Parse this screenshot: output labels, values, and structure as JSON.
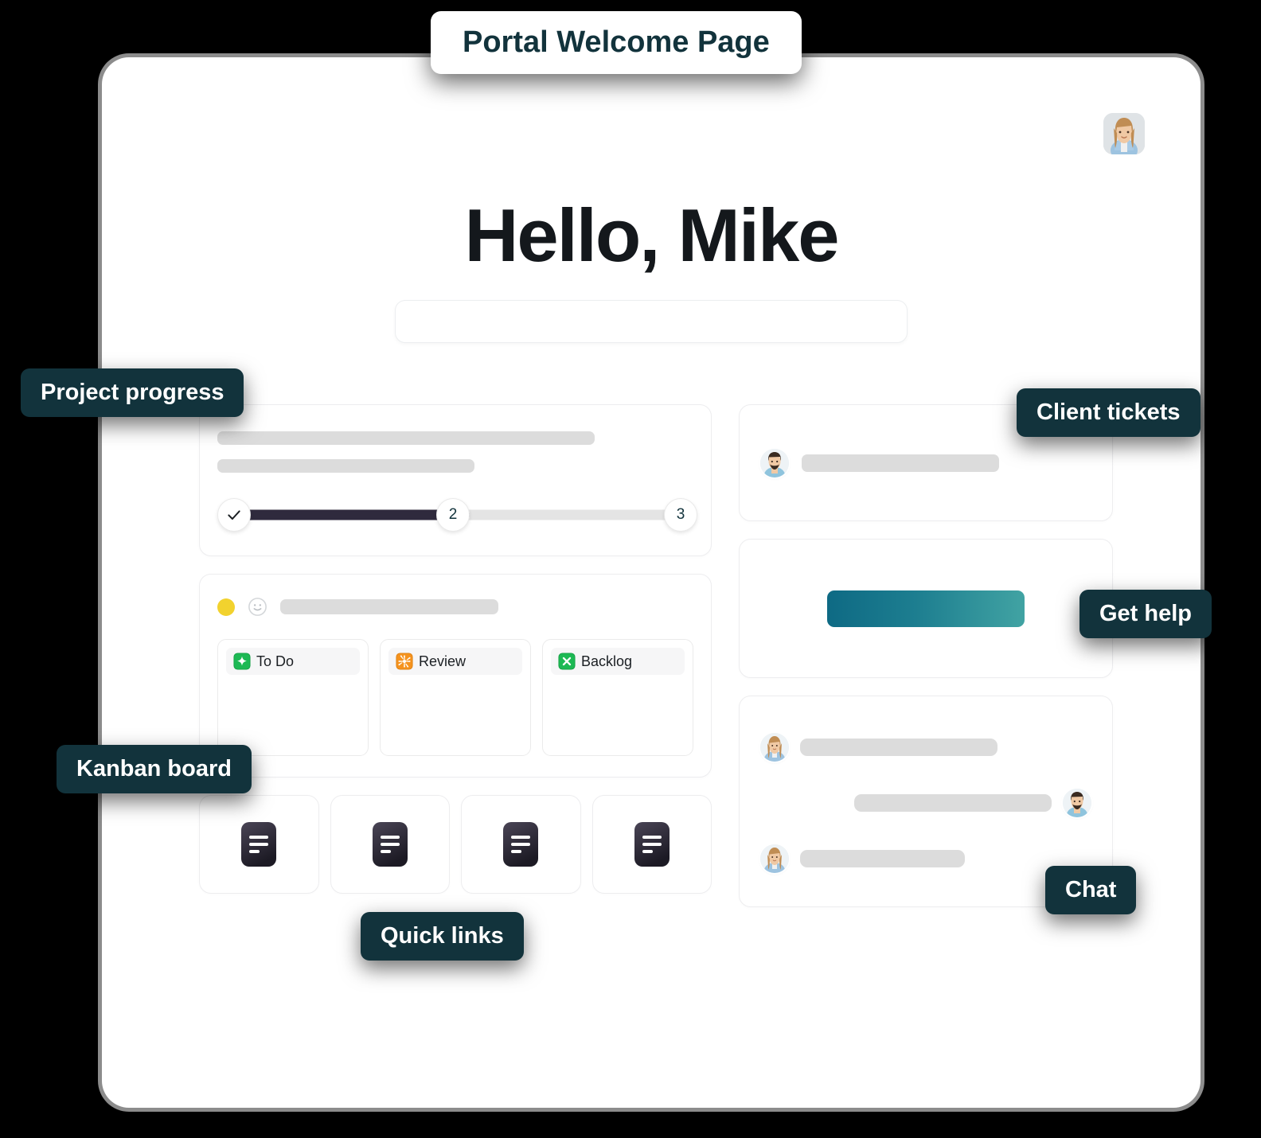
{
  "title_pill": {
    "label": "Portal Welcome Page"
  },
  "header": {
    "greeting": "Hello, Mike",
    "avatar_icon": "user-avatar-woman"
  },
  "search": {
    "value": "",
    "placeholder": ""
  },
  "progress_card": {
    "steps": [
      {
        "label": "",
        "icon": "check-icon",
        "state": "complete"
      },
      {
        "label": "2",
        "state": "current"
      },
      {
        "label": "3",
        "state": "upcoming"
      }
    ],
    "fill_percent": 47
  },
  "kanban_card": {
    "status_dot_color": "#f2d22e",
    "smiley_icon": "smiley-face-icon",
    "columns": [
      {
        "label": "To Do",
        "icon": "green-sparkle-icon",
        "icon_color": "#1db954"
      },
      {
        "label": "Review",
        "icon": "orange-star-icon",
        "icon_color": "#f5931e"
      },
      {
        "label": "Backlog",
        "icon": "green-x-icon",
        "icon_color": "#1db954"
      }
    ]
  },
  "quick_links": {
    "tiles": [
      {
        "icon": "document-icon"
      },
      {
        "icon": "document-icon"
      },
      {
        "icon": "document-icon"
      },
      {
        "icon": "document-icon"
      }
    ]
  },
  "tickets_card": {
    "rows": [
      {
        "avatar_icon": "user-avatar-man"
      }
    ]
  },
  "help_card": {
    "button_label": "",
    "button_gradient_from": "#0e6a84",
    "button_gradient_to": "#41a3a3"
  },
  "chat_card": {
    "messages": [
      {
        "side": "left",
        "avatar_icon": "user-avatar-woman"
      },
      {
        "side": "right",
        "avatar_icon": "user-avatar-man"
      },
      {
        "side": "left",
        "avatar_icon": "user-avatar-woman"
      }
    ]
  },
  "annotations": {
    "project_progress": "Project progress",
    "client_tickets": "Client tickets",
    "get_help": "Get help",
    "kanban_board": "Kanban board",
    "quick_links": "Quick links",
    "chat": "Chat"
  },
  "colors": {
    "annotation_bg": "#12333c",
    "progress_fill": "#2f2a3d",
    "accent_teal": "#1d7e90"
  }
}
